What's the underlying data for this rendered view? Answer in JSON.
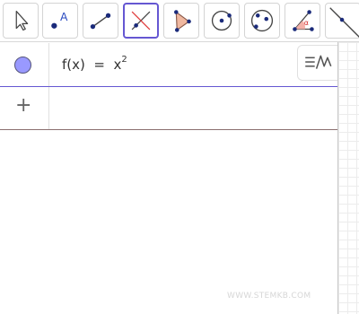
{
  "toolbar": {
    "tools": [
      {
        "name": "move-tool",
        "icon": "cursor-arrow-icon",
        "active": false
      },
      {
        "name": "point-tool",
        "icon": "point-with-label-icon",
        "label_char": "A",
        "active": false
      },
      {
        "name": "segment-tool",
        "icon": "segment-icon",
        "active": false
      },
      {
        "name": "perpendicular-line-tool",
        "icon": "perpendicular-line-icon",
        "active": true
      },
      {
        "name": "polygon-tool",
        "icon": "polygon-icon",
        "active": false
      },
      {
        "name": "circle-center-point-tool",
        "icon": "circle-with-center-icon",
        "active": false
      },
      {
        "name": "circle-through-points-tool",
        "icon": "circle-through-points-icon",
        "active": false
      },
      {
        "name": "angle-tool",
        "icon": "angle-icon",
        "label_char": "α",
        "active": false
      },
      {
        "name": "line-tool",
        "icon": "line-icon",
        "active": false
      }
    ],
    "active_color": "#6557d2"
  },
  "algebra": {
    "rows": [
      {
        "name": "f",
        "formula_base": "f(x)  =  x",
        "exponent": "2",
        "marble_color": "#9999ff"
      },
      {
        "name": "input",
        "plus": "+"
      }
    ]
  },
  "style_bar": {
    "icon": "algebra-style-icon"
  },
  "watermark": "WWW.STEMKB.COM"
}
